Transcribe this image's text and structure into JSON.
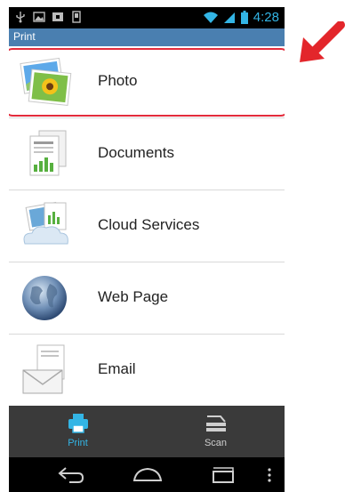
{
  "status_bar": {
    "time": "4:28"
  },
  "title_bar": {
    "title": "Print"
  },
  "list": {
    "items": [
      {
        "label": "Photo",
        "icon": "photo-icon"
      },
      {
        "label": "Documents",
        "icon": "documents-icon"
      },
      {
        "label": "Cloud Services",
        "icon": "cloud-services-icon"
      },
      {
        "label": "Web Page",
        "icon": "globe-icon"
      },
      {
        "label": "Email",
        "icon": "envelope-icon"
      }
    ]
  },
  "action_bar": {
    "tabs": [
      {
        "label": "Print",
        "icon": "printer-icon"
      },
      {
        "label": "Scan",
        "icon": "scanner-icon"
      }
    ]
  },
  "colors": {
    "status_bar": "#000000",
    "title_bar": "#4a7fb0",
    "highlight": "#e32b3b",
    "accent": "#33b5e5",
    "action_bar": "#3a3a3a"
  }
}
